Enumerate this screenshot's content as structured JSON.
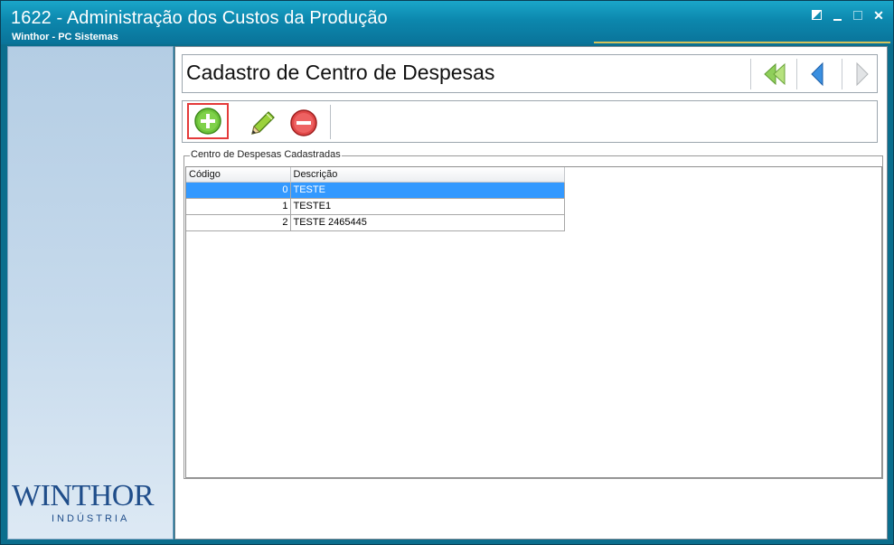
{
  "window": {
    "title": "1622 - Administração dos Custos da Produção",
    "subtitle": "Winthor - PC Sistemas"
  },
  "logo": {
    "word": "WINTHOR",
    "sub": "INDÚSTRIA"
  },
  "page": {
    "title": "Cadastro de Centro de Despesas"
  },
  "navigation": {
    "first_icon": "double-left-arrow-icon",
    "prev_icon": "left-arrow-icon",
    "next_icon": "right-arrow-icon"
  },
  "toolbar": {
    "add_icon": "plus-circle-icon",
    "edit_icon": "pencil-icon",
    "delete_icon": "minus-circle-icon"
  },
  "group": {
    "label": "Centro de Despesas Cadastradas",
    "columns": [
      "Código",
      "Descrição"
    ],
    "rows": [
      {
        "codigo": "0",
        "descricao": "TESTE",
        "selected": true
      },
      {
        "codigo": "1",
        "descricao": "TESTE1",
        "selected": false
      },
      {
        "codigo": "2",
        "descricao": "TESTE 2465445",
        "selected": false
      }
    ]
  },
  "colors": {
    "titlebar": "#0c87ad",
    "selection": "#3399ff",
    "highlight_border": "#e43a3a"
  }
}
